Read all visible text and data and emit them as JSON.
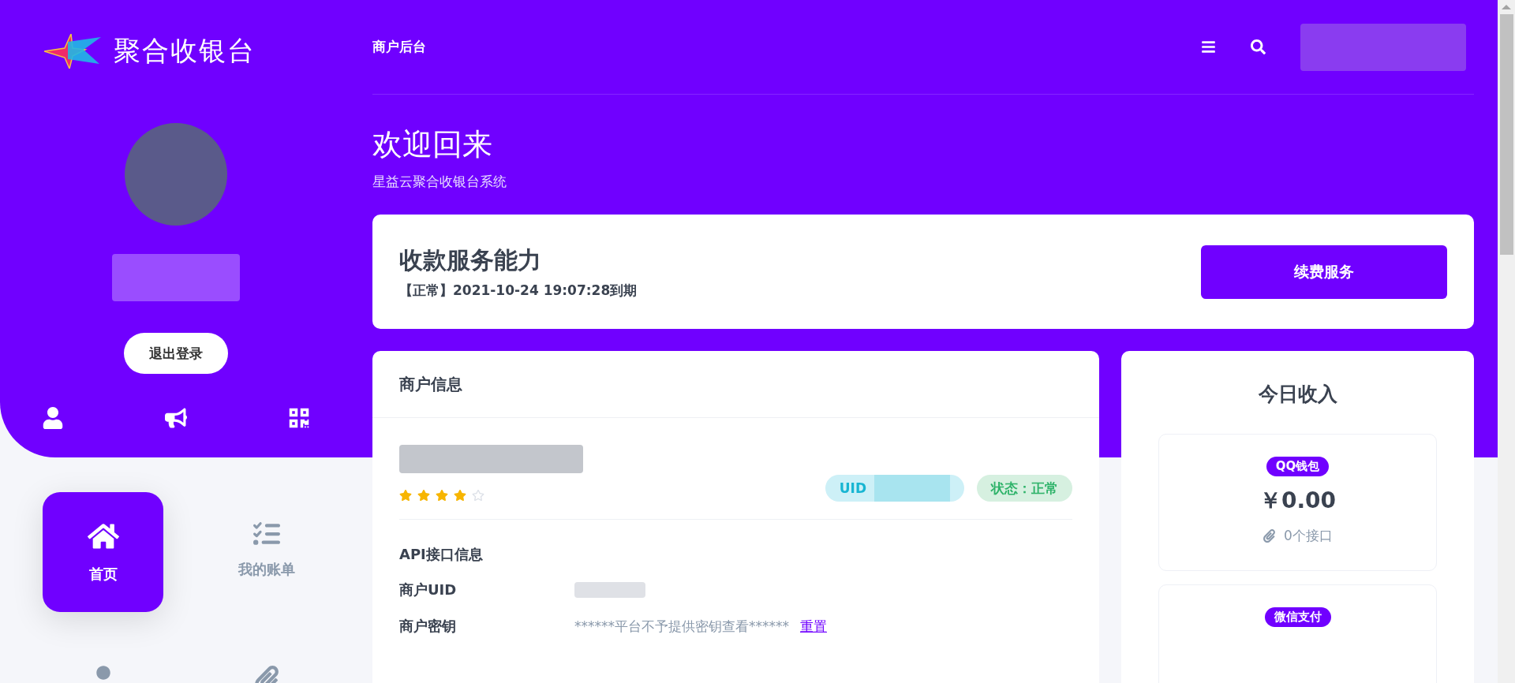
{
  "brand": {
    "name": "聚合收银台"
  },
  "sidebar": {
    "logout": "退出登录",
    "quick_icons": [
      {
        "kind": "user"
      },
      {
        "kind": "megaphone"
      },
      {
        "kind": "qrcode"
      }
    ],
    "nav": [
      {
        "kind": "home",
        "label": "首页",
        "selected": true
      },
      {
        "kind": "checklist",
        "label": "我的账单",
        "selected": false
      },
      {
        "kind": "dot",
        "selected": false
      },
      {
        "kind": "paperclip",
        "selected": false
      }
    ]
  },
  "topbar": {
    "title": "商户后台"
  },
  "welcome": {
    "title": "欢迎回来",
    "subtitle": "星益云聚合收银台系统"
  },
  "service": {
    "title": "收款服务能力",
    "status": "【正常】2021-10-24 19:07:28到期",
    "button": "续费服务"
  },
  "merchant": {
    "title": "商户信息",
    "stars": 4,
    "uid_label": "UID",
    "status_badge": "状态：正常",
    "api_title": "API接口信息",
    "rows": [
      {
        "label": "商户UID"
      },
      {
        "label": "商户密钥",
        "value": "******平台不予提供密钥查看******",
        "link": "重置"
      }
    ]
  },
  "income": {
    "title": "今日收入",
    "channels": [
      {
        "name": "QQ钱包",
        "amount": "￥0.00",
        "interfaces": "0个接口"
      },
      {
        "name": "微信支付"
      }
    ]
  }
}
